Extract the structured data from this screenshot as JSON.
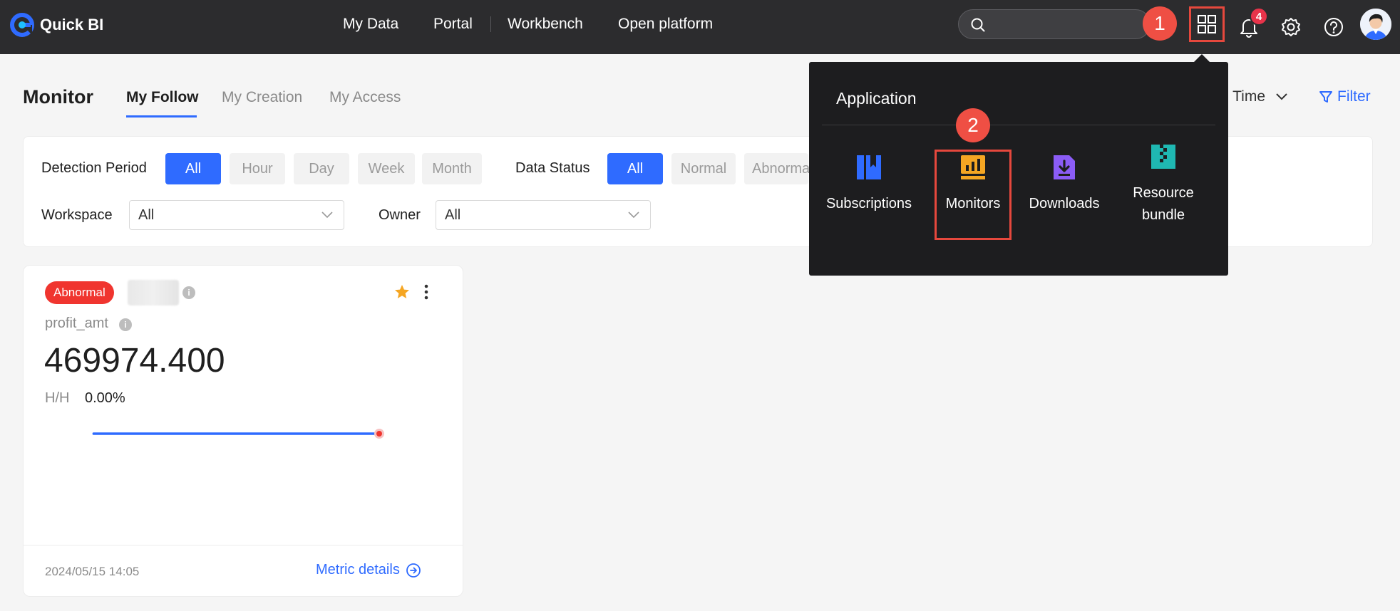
{
  "app": {
    "name": "Quick BI"
  },
  "nav": {
    "items": [
      "My Data",
      "Portal",
      "Workbench",
      "Open platform"
    ]
  },
  "notifications": {
    "count": "4"
  },
  "steps": {
    "one": "1",
    "two": "2"
  },
  "page": {
    "title": "Monitor",
    "tabs": [
      "My Follow",
      "My Creation",
      "My Access"
    ],
    "sort_label": "e Time",
    "filter_label": "Filter"
  },
  "filters": {
    "detection_period": {
      "label": "Detection Period",
      "options": [
        "All",
        "Hour",
        "Day",
        "Week",
        "Month"
      ],
      "selected": "All"
    },
    "data_status": {
      "label": "Data Status",
      "options": [
        "All",
        "Normal",
        "Abnorma"
      ],
      "selected": "All"
    },
    "workspace": {
      "label": "Workspace",
      "value": "All"
    },
    "owner": {
      "label": "Owner",
      "value": "All"
    }
  },
  "card": {
    "status": "Abnormal",
    "metric": "profit_amt",
    "value": "469974.400",
    "change_label": "H/H",
    "change_value": "0.00%",
    "timestamp": "2024/05/15 14:05",
    "details_link": "Metric details",
    "favorited": true
  },
  "application_menu": {
    "title": "Application",
    "items": [
      {
        "label": "Subscriptions",
        "icon": "subscriptions-icon",
        "color": "#2f6bff"
      },
      {
        "label": "Monitors",
        "icon": "monitors-icon",
        "color": "#f5a623"
      },
      {
        "label": "Downloads",
        "icon": "downloads-icon",
        "color": "#8b5cf6"
      },
      {
        "label": "Resource bundle",
        "icon": "resource-bundle-icon",
        "color": "#1fb8b2"
      }
    ]
  },
  "colors": {
    "accent": "#2f6bff",
    "topbar": "#2c2c2e",
    "abnormal": "#f0352f",
    "highlight": "#e6483d"
  }
}
